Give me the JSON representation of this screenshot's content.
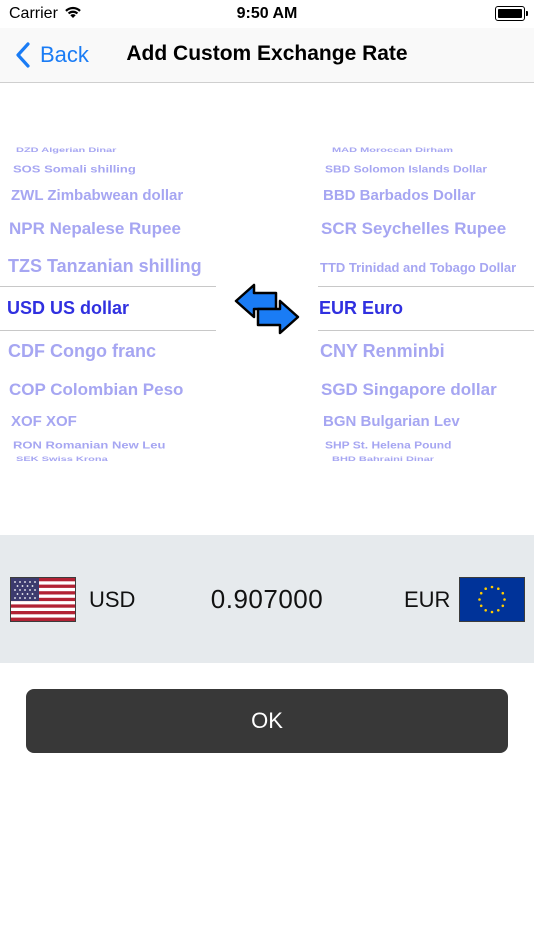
{
  "status": {
    "carrier": "Carrier",
    "time": "9:50 AM"
  },
  "nav": {
    "back_label": "Back",
    "title": "Add Custom Exchange Rate"
  },
  "left_picker": {
    "items": [
      "DZD Algerian Dinar",
      "SOS Somali shilling",
      "ZWL Zimbabwean dollar",
      "NPR Nepalese Rupee",
      "TZS Tanzanian shilling",
      "USD US dollar",
      "CDF Congo franc",
      "COP Colombian Peso",
      "XOF XOF",
      "RON Romanian New Leu",
      "SEK Swiss Krona"
    ]
  },
  "right_picker": {
    "items": [
      "MAD Moroccan Dirham",
      "SBD Solomon Islands Dollar",
      "BBD Barbados Dollar",
      "SCR Seychelles Rupee",
      "TTD Trinidad and Tobago Dollar",
      "EUR Euro",
      "CNY Renminbi",
      "SGD Singapore dollar",
      "BGN Bulgarian Lev",
      "SHP St. Helena Pound",
      "BHD Bahraini Dinar"
    ]
  },
  "rate": {
    "from_code": "USD",
    "value": "0.907000",
    "to_code": "EUR"
  },
  "ok_label": "OK",
  "colors": {
    "accent": "#1a7cf5",
    "selected": "#3030e0",
    "faded": "#a6a6f2",
    "button": "#383838"
  }
}
